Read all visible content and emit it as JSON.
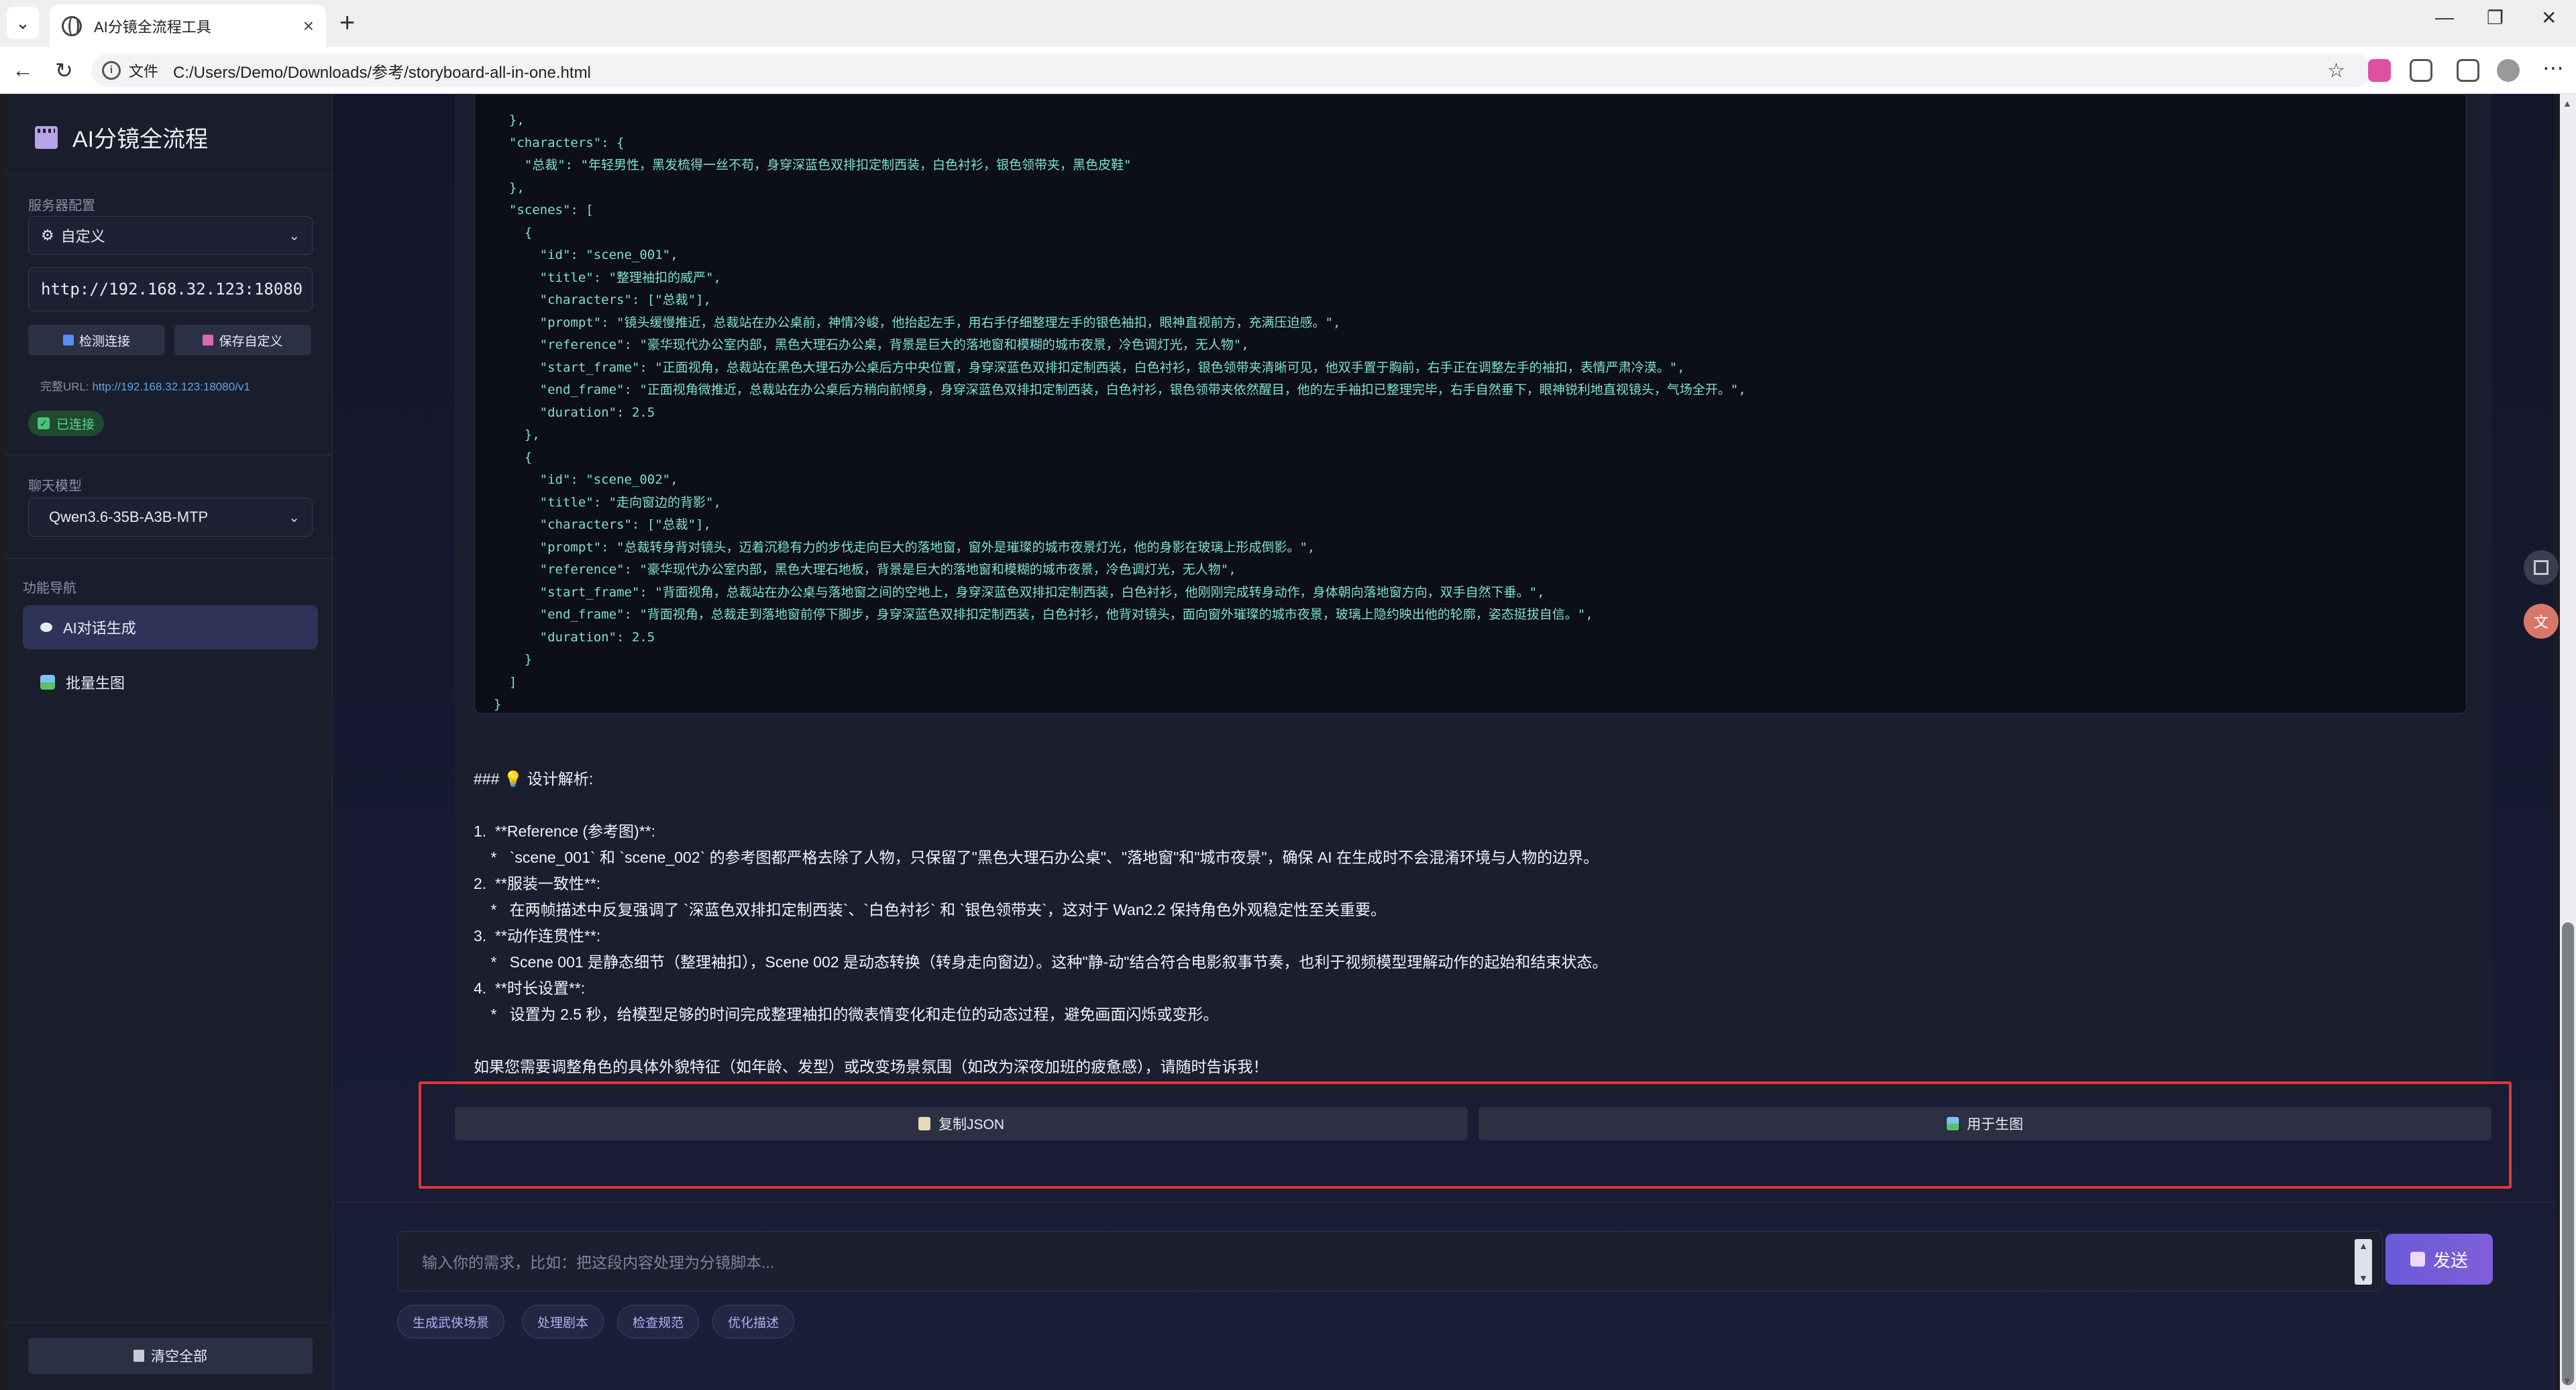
{
  "browser": {
    "tab_title": "AI分镜全流程工具",
    "file_label": "文件",
    "url": "C:/Users/Demo/Downloads/参考/storyboard-all-in-one.html"
  },
  "sidebar": {
    "brand": "AI分镜全流程",
    "server_section": "服务器配置",
    "server_preset": "自定义",
    "server_url": "http://192.168.32.123:18080",
    "check_btn": "检测连接",
    "save_btn": "保存自定义",
    "full_url_label": "完整URL:",
    "full_url": "http://192.168.32.123:18080/v1",
    "status": "已连接",
    "model_section": "聊天模型",
    "model": "Qwen3.6-35B-A3B-MTP",
    "nav_section": "功能导航",
    "nav_items": [
      {
        "label": "AI对话生成",
        "active": true
      },
      {
        "label": "批量生图",
        "active": false
      }
    ],
    "clear_btn": "清空全部"
  },
  "code_lines": [
    "  },",
    "  \"characters\": {",
    "    \"总裁\": \"年轻男性，黑发梳得一丝不苟，身穿深蓝色双排扣定制西装，白色衬衫，银色领带夹，黑色皮鞋\"",
    "  },",
    "  \"scenes\": [",
    "    {",
    "      \"id\": \"scene_001\",",
    "      \"title\": \"整理袖扣的威严\",",
    "      \"characters\": [\"总裁\"],",
    "      \"prompt\": \"镜头缓慢推近，总裁站在办公桌前，神情冷峻，他抬起左手，用右手仔细整理左手的银色袖扣，眼神直视前方，充满压迫感。\",",
    "      \"reference\": \"豪华现代办公室内部，黑色大理石办公桌，背景是巨大的落地窗和模糊的城市夜景，冷色调灯光，无人物\",",
    "      \"start_frame\": \"正面视角，总裁站在黑色大理石办公桌后方中央位置，身穿深蓝色双排扣定制西装，白色衬衫，银色领带夹清晰可见，他双手置于胸前，右手正在调整左手的袖扣，表情严肃冷漠。\",",
    "      \"end_frame\": \"正面视角微推近，总裁站在办公桌后方稍向前倾身，身穿深蓝色双排扣定制西装，白色衬衫，银色领带夹依然醒目，他的左手袖扣已整理完毕，右手自然垂下，眼神锐利地直视镜头，气场全开。\",",
    "      \"duration\": 2.5",
    "    },",
    "    {",
    "      \"id\": \"scene_002\",",
    "      \"title\": \"走向窗边的背影\",",
    "      \"characters\": [\"总裁\"],",
    "      \"prompt\": \"总裁转身背对镜头，迈着沉稳有力的步伐走向巨大的落地窗，窗外是璀璨的城市夜景灯光，他的身影在玻璃上形成倒影。\",",
    "      \"reference\": \"豪华现代办公室内部，黑色大理石地板，背景是巨大的落地窗和模糊的城市夜景，冷色调灯光，无人物\",",
    "      \"start_frame\": \"背面视角，总裁站在办公桌与落地窗之间的空地上，身穿深蓝色双排扣定制西装，白色衬衫，他刚刚完成转身动作，身体朝向落地窗方向，双手自然下垂。\",",
    "      \"end_frame\": \"背面视角，总裁走到落地窗前停下脚步，身穿深蓝色双排扣定制西装，白色衬衫，他背对镜头，面向窗外璀璨的城市夜景，玻璃上隐约映出他的轮廓，姿态挺拔自信。\",",
    "      \"duration\": 2.5",
    "    }",
    "  ]",
    "}"
  ],
  "explanation": [
    "### 💡 设计解析:",
    "",
    "1.  **Reference (参考图)**:",
    "    *   `scene_001` 和 `scene_002` 的参考图都严格去除了人物，只保留了\"黑色大理石办公桌\"、\"落地窗\"和\"城市夜景\"，确保 AI 在生成时不会混淆环境与人物的边界。",
    "2.  **服装一致性**:",
    "    *   在两帧描述中反复强调了 `深蓝色双排扣定制西装`、`白色衬衫` 和 `银色领带夹`，这对于 Wan2.2 保持角色外观稳定性至关重要。",
    "3.  **动作连贯性**:",
    "    *   Scene 001 是静态细节（整理袖扣），Scene 002 是动态转换（转身走向窗边）。这种\"静-动\"结合符合电影叙事节奏，也利于视频模型理解动作的起始和结束状态。",
    "4.  **时长设置**:",
    "    *   设置为 2.5 秒，给模型足够的时间完成整理袖扣的微表情变化和走位的动态过程，避免画面闪烁或变形。",
    "",
    "如果您需要调整角色的具体外貌特征（如年龄、发型）或改变场景氛围（如改为深夜加班的疲惫感），请随时告诉我！"
  ],
  "actions": {
    "copy_json": "复制JSON",
    "use_for_image": "用于生图"
  },
  "chat": {
    "placeholder": "输入你的需求，比如：把这段内容处理为分镜脚本...",
    "send": "发送",
    "quick_chips": [
      "生成武侠场景",
      "处理剧本",
      "检查规范",
      "优化描述"
    ]
  },
  "colors": {
    "accent": "#6a5ad8",
    "code_text": "#7ee0d2",
    "highlight": "#e0363a",
    "connected": "#5fd38a"
  }
}
